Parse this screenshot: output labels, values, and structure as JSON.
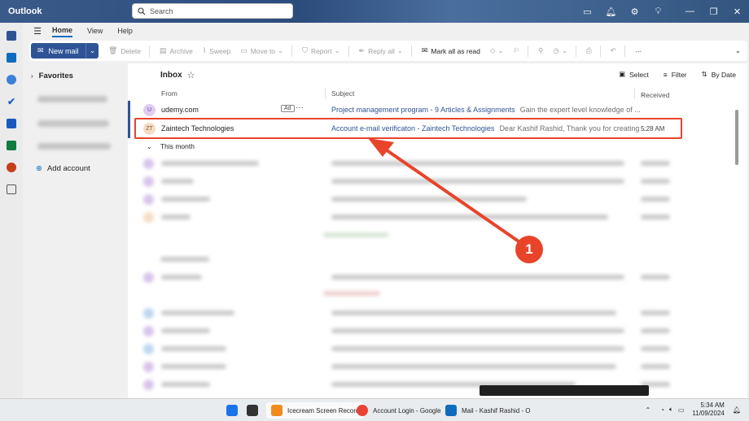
{
  "app": {
    "title": "Outlook"
  },
  "search": {
    "placeholder": "Search"
  },
  "titlebar_icons": [
    "meet-now-icon",
    "bell-icon",
    "gear-icon",
    "lightbulb-icon"
  ],
  "ribbon_tabs": [
    "Home",
    "View",
    "Help"
  ],
  "toolbar": {
    "new_mail": "New mail",
    "delete": "Delete",
    "archive": "Archive",
    "sweep": "Sweep",
    "move_to": "Move to",
    "report": "Report",
    "reply_all": "Reply all",
    "mark_all_read": "Mark all as read"
  },
  "folders": {
    "favorites": "Favorites",
    "add_account": "Add account"
  },
  "mail": {
    "inbox_title": "Inbox",
    "select": "Select",
    "filter": "Filter",
    "by_date": "By Date",
    "col_from": "From",
    "col_subject": "Subject",
    "col_received": "Received",
    "group_this_month": "This month",
    "messages": [
      {
        "initials": "U",
        "from": "udemy.com",
        "ad": "Ad",
        "subject": "Project management program - 9 Articles & Assignments",
        "preview": "Gain the expert level knowledge of ...",
        "time": "",
        "avatar_color": "#e0cdf0",
        "avatar_text_color": "#6b3fa0"
      },
      {
        "initials": "ZT",
        "from": "Zaintech Technologies",
        "ad": "",
        "subject": "Account e-mail verificaton - Zaintech Technologies",
        "preview": "Dear Kashif Rashid, Thank you for creating ...",
        "time": "5:28 AM",
        "avatar_color": "#f6dcc4",
        "avatar_text_color": "#8a5a2a"
      }
    ]
  },
  "annotation": {
    "number": "1",
    "color": "#e8442a"
  },
  "taskbar": {
    "apps": [
      "Icecream Screen Record",
      "Account Login - Google",
      "Mail - Kashif Rashid - O"
    ],
    "time": "5:34 AM",
    "date": "11/09/2024"
  }
}
